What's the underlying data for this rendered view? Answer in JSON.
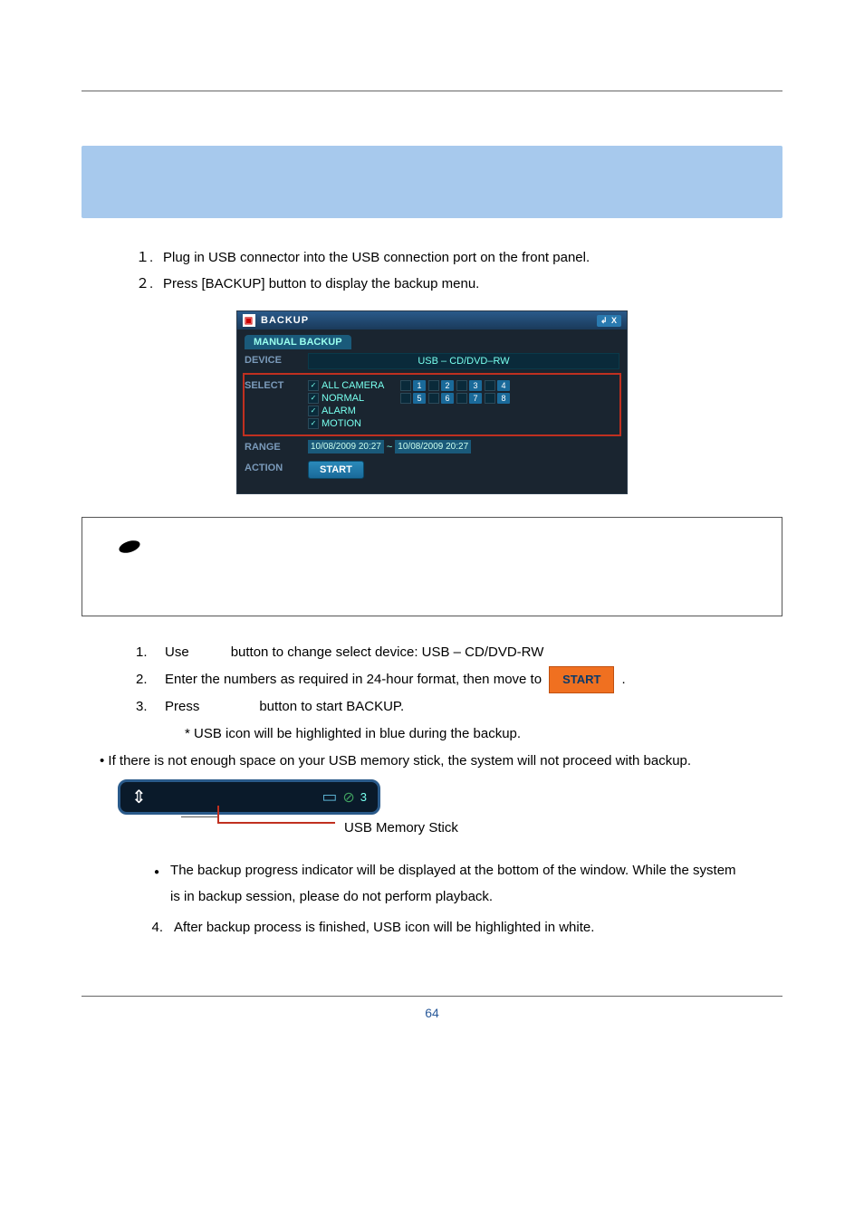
{
  "steps_top": [
    {
      "num": "１.",
      "text": "Plug in USB connector into the USB connection port on the front panel."
    },
    {
      "num": "２.",
      "text": "Press [BACKUP] button to display the backup menu."
    }
  ],
  "backup_window": {
    "title": "BACKUP",
    "tab": "MANUAL BACKUP",
    "device_label": "DEVICE",
    "device_value": "USB – CD/DVD–RW",
    "select_label": "SELECT",
    "checks": [
      "ALL CAMERA",
      "NORMAL",
      "ALARM",
      "MOTION"
    ],
    "cams_row1": [
      "1",
      "2",
      "3",
      "4"
    ],
    "cams_row2": [
      "5",
      "6",
      "7",
      "8"
    ],
    "range_label": "RANGE",
    "range_from": "10/08/2009 20:27",
    "range_to": "10/08/2009 20:27",
    "range_sep": "~",
    "action_label": "ACTION",
    "start": "START",
    "win_btns": "↲ X"
  },
  "steps_mid": [
    {
      "idx": "1.",
      "pre": "Use",
      "post": "button to change select device: USB – CD/DVD-RW"
    },
    {
      "idx": "2.",
      "pre": "Enter the numbers as required in 24-hour format, then move to",
      "btn": "START",
      "post": "."
    },
    {
      "idx": "3.",
      "pre": "Press",
      "post": "button to start BACKUP."
    }
  ],
  "usb_note": "* USB icon will be highlighted in blue during the backup.",
  "no_space": "• If there is not enough space on your USB memory stick, the system will not proceed with backup.",
  "usb_label": "USB Memory Stick",
  "usb_bar": {
    "count": "3"
  },
  "bullets": [
    "The backup progress indicator will be displayed at the bottom of the window. While the system is in backup session, please do not perform playback."
  ],
  "step4": {
    "idx": "4.",
    "text": "After backup process is finished, USB icon will be highlighted in white."
  },
  "page_number": "64"
}
